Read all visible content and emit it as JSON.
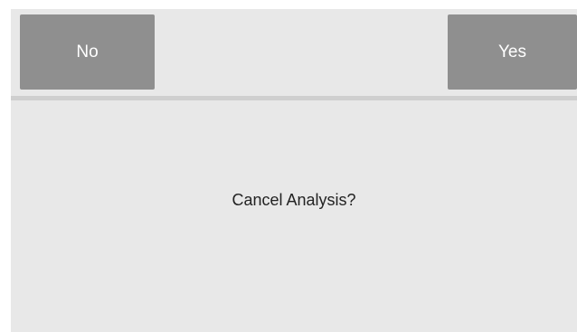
{
  "dialog": {
    "no_label": "No",
    "yes_label": "Yes",
    "message": "Cancel Analysis?"
  }
}
